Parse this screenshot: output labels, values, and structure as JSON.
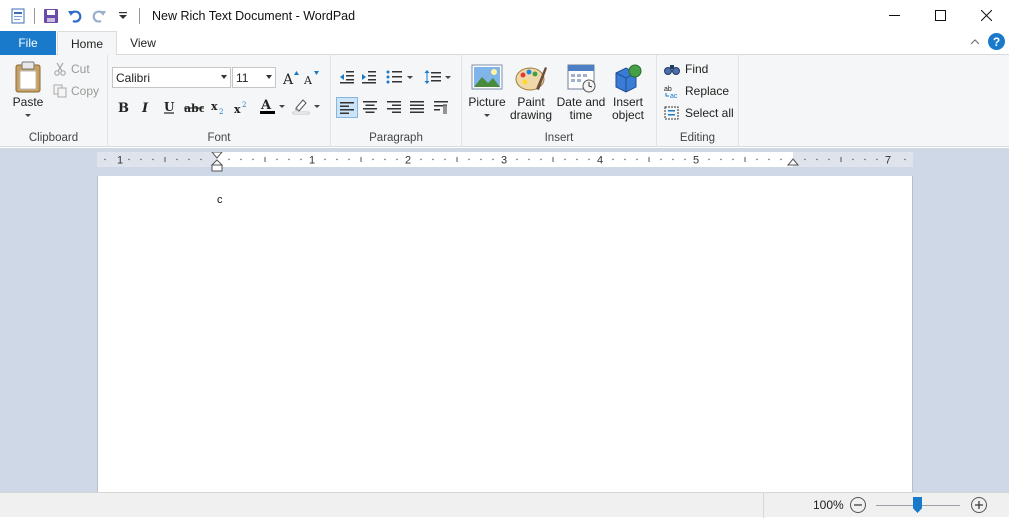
{
  "window": {
    "title": "New Rich Text Document - WordPad",
    "controls": [
      "minimize",
      "maximize",
      "close"
    ]
  },
  "quick_access": {
    "icons": [
      "wordpad-app-icon",
      "save-icon",
      "undo-icon",
      "redo-icon",
      "customize-qat-icon"
    ]
  },
  "tabs": {
    "file": "File",
    "home": "Home",
    "view": "View",
    "help": "?"
  },
  "ribbon": {
    "clipboard": {
      "label": "Clipboard",
      "paste": "Paste",
      "cut": "Cut",
      "copy": "Copy"
    },
    "font": {
      "label": "Font",
      "family": "Calibri",
      "size": "11"
    },
    "paragraph": {
      "label": "Paragraph"
    },
    "insert": {
      "label": "Insert",
      "picture": "Picture",
      "paint_line1": "Paint",
      "paint_line2": "drawing",
      "datetime_line1": "Date and",
      "datetime_line2": "time",
      "object_line1": "Insert",
      "object_line2": "object"
    },
    "editing": {
      "label": "Editing",
      "find": "Find",
      "replace": "Replace",
      "select_all": "Select all"
    }
  },
  "ruler": {
    "numbers": [
      "1",
      "1",
      "2",
      "3",
      "4",
      "5",
      "7"
    ]
  },
  "document": {
    "content": "c"
  },
  "status": {
    "zoom": "100%",
    "zoom_fraction": 0.5
  },
  "colors": {
    "accent": "#1979ca",
    "font_color": "#000000",
    "highlight": "#ffffff"
  }
}
